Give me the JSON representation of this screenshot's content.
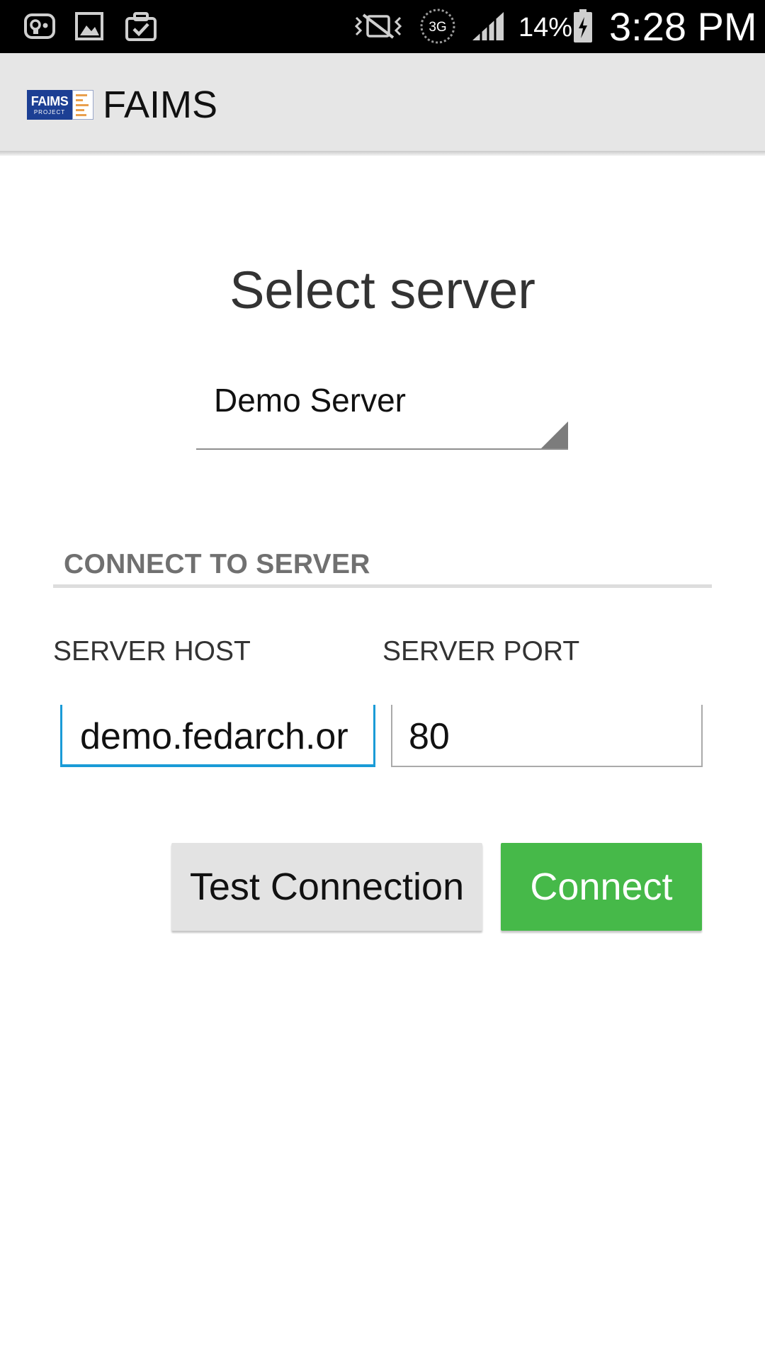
{
  "status_bar": {
    "icons": {
      "left": [
        "voicemail-icon",
        "gallery-icon",
        "clipboard-check-icon"
      ],
      "right": [
        "vibrate-mute-icon",
        "network-3g-icon",
        "signal-icon",
        "battery-charging-icon"
      ]
    },
    "network_label": "3G",
    "battery_percent": "14%",
    "time": "3:28 PM"
  },
  "app_bar": {
    "logo_text": "FAIMS",
    "logo_subtext": "PROJECT",
    "title": "FAIMS",
    "background": "#e6e6e6"
  },
  "main": {
    "heading": "Select server",
    "server_select": {
      "selected": "Demo Server"
    },
    "section_header": "CONNECT TO SERVER",
    "host_field": {
      "label": "SERVER HOST",
      "value": "demo.fedarch.or",
      "accent": "#1a9bd7"
    },
    "port_field": {
      "label": "SERVER PORT",
      "value": "80"
    },
    "buttons": {
      "test_connection": "Test Connection",
      "connect": "Connect",
      "connect_color": "#46b949"
    }
  }
}
